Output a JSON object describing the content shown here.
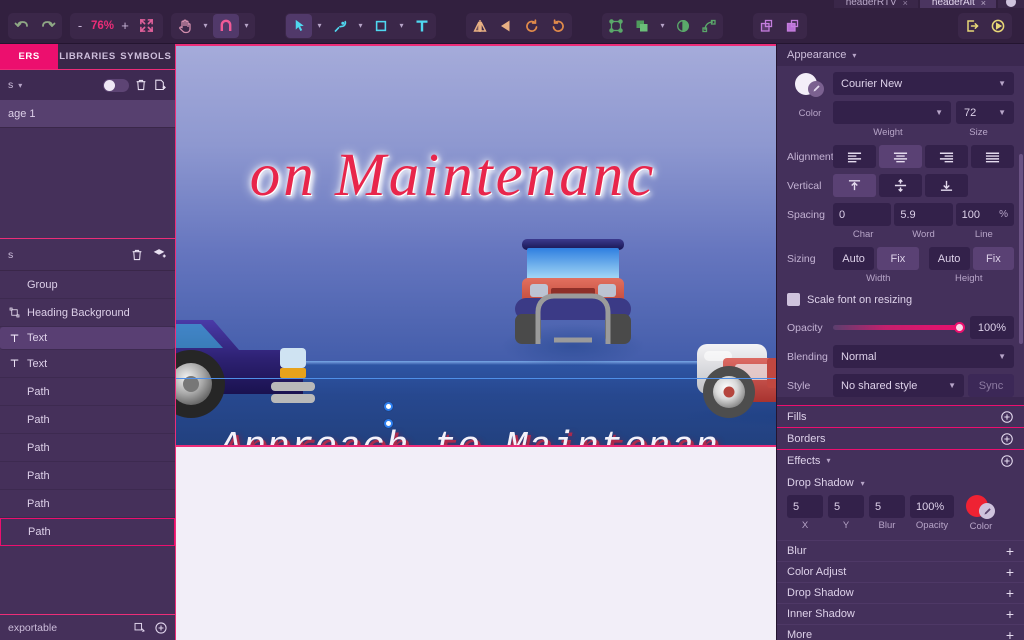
{
  "window": {
    "tabs": [
      {
        "label": "headerRTV",
        "close": "×",
        "active": false
      },
      {
        "label": "headerAlt",
        "close": "×",
        "active": true
      }
    ]
  },
  "toolbar": {
    "undo_icon": "undo-arrow-icon",
    "redo_icon": "redo-arrow-icon",
    "zoom_minus": "-",
    "zoom_value": "76%",
    "zoom_plus": "+",
    "fit_icon": "fit-to-screen-icon",
    "hand_icon": "hand-tool-icon",
    "snap_icon": "magnet-snap-icon",
    "select_icon": "pointer-select-icon",
    "pen_icon": "pen-tool-icon",
    "shape_icon": "rectangle-shape-icon",
    "text_icon": "text-tool-icon",
    "flip_h_icon": "flip-horizontal-icon",
    "flip_v_icon": "flip-vertical-icon",
    "rotate_ccw_icon": "rotate-counterclockwise-icon",
    "rotate_cw_icon": "rotate-clockwise-icon",
    "transform_icon": "transform-node-icon",
    "boolean_icon": "boolean-union-icon",
    "mask_icon": "mask-icon",
    "convert_icon": "convert-to-path-icon",
    "group_icon": "group-objects-icon",
    "ungroup_icon": "ungroup-objects-icon",
    "export_icon": "export-icon",
    "preview_icon": "preview-play-icon",
    "caret": "▾"
  },
  "left_panel": {
    "tabs": [
      {
        "label": "ERS",
        "active": true
      },
      {
        "label": "LIBRARIES",
        "active": false
      },
      {
        "label": "SYMBOLS",
        "active": false
      }
    ],
    "pages_header": {
      "label": "s",
      "caret": "▾",
      "toggle": "visibility-toggle",
      "delete_icon": "trash-icon",
      "add_icon": "add-page-icon"
    },
    "pages": [
      {
        "label": "age 1",
        "selected": true
      }
    ],
    "layers_header": {
      "label": "s",
      "delete_icon": "trash-icon",
      "add_icon": "add-layer-icon"
    },
    "layers": [
      {
        "label": "Group",
        "icon": "",
        "selected": false,
        "outlined": false
      },
      {
        "label": "Heading Background",
        "icon": "path-node-icon",
        "selected": false,
        "outlined": false
      },
      {
        "label": "Text",
        "icon": "T",
        "selected": true,
        "outlined": false
      },
      {
        "label": "Text",
        "icon": "T",
        "selected": false,
        "outlined": false
      },
      {
        "label": "Path",
        "icon": "",
        "selected": false,
        "outlined": false
      },
      {
        "label": "Path",
        "icon": "",
        "selected": false,
        "outlined": false
      },
      {
        "label": "Path",
        "icon": "",
        "selected": false,
        "outlined": false
      },
      {
        "label": "Path",
        "icon": "",
        "selected": false,
        "outlined": false
      },
      {
        "label": "Path",
        "icon": "",
        "selected": false,
        "outlined": false
      },
      {
        "label": "Path",
        "icon": "",
        "selected": false,
        "outlined": true
      }
    ],
    "footer": {
      "label": "exportable",
      "slices_icon": "slice-icon",
      "add_icon": "add-circle-icon"
    }
  },
  "canvas": {
    "headline": "on Maintenanc",
    "subline": "Approach  to  Maintenan",
    "selection": "text-selection-handles"
  },
  "appearance": {
    "title": "Appearance",
    "caret": "▾",
    "color_label": "Color",
    "font_family": "Courier New",
    "weight_value": "",
    "weight_label": "Weight",
    "size_value": "72",
    "size_label": "Size",
    "alignment_label": "Alignment",
    "alignment_options": [
      "align-left",
      "align-center",
      "align-right",
      "align-justify"
    ],
    "alignment_selected": 1,
    "vertical_label": "Vertical",
    "vertical_options": [
      "valign-top",
      "valign-middle",
      "valign-bottom"
    ],
    "vertical_selected": 0,
    "spacing_label": "Spacing",
    "spacing_char": "0",
    "spacing_word": "5.9",
    "spacing_line": "100",
    "spacing_line_unit": "%",
    "spacing_caps": [
      "Char",
      "Word",
      "Line"
    ],
    "sizing_label": "Sizing",
    "sizing_width": [
      "Auto",
      "Fix"
    ],
    "sizing_width_selected": 1,
    "sizing_height": [
      "Auto",
      "Fix"
    ],
    "sizing_height_selected": 1,
    "sizing_caps": [
      "Width",
      "Height"
    ],
    "scale_font_label": "Scale font on resizing",
    "scale_font_checked": true,
    "opacity_label": "Opacity",
    "opacity_value": "100%",
    "blending_label": "Blending",
    "blending_value": "Normal",
    "style_label": "Style",
    "style_value": "No shared style",
    "sync_label": "Sync"
  },
  "sections": {
    "fills": "Fills",
    "borders": "Borders",
    "effects": "Effects",
    "add_icon": "add-circle-icon"
  },
  "effects": {
    "active_name": "Drop Shadow",
    "caret": "▾",
    "x_value": "5",
    "x_label": "X",
    "y_value": "5",
    "y_label": "Y",
    "blur_value": "5",
    "blur_label": "Blur",
    "opacity_value": "100%",
    "opacity_label": "Opacity",
    "color_label": "Color",
    "color_hex": "#ef2233",
    "available": [
      {
        "label": "Blur",
        "plus": "+"
      },
      {
        "label": "Color Adjust",
        "plus": "+"
      },
      {
        "label": "Drop Shadow",
        "plus": "+"
      },
      {
        "label": "Inner Shadow",
        "plus": "+"
      },
      {
        "label": "More",
        "plus": "+"
      }
    ]
  },
  "colors": {
    "accent_pink": "#ec0f6e",
    "panel_bg": "#44305b",
    "toolbar_bg": "#32204 0",
    "headline_red": "#e8264b",
    "shadow_red": "#ef2233"
  }
}
